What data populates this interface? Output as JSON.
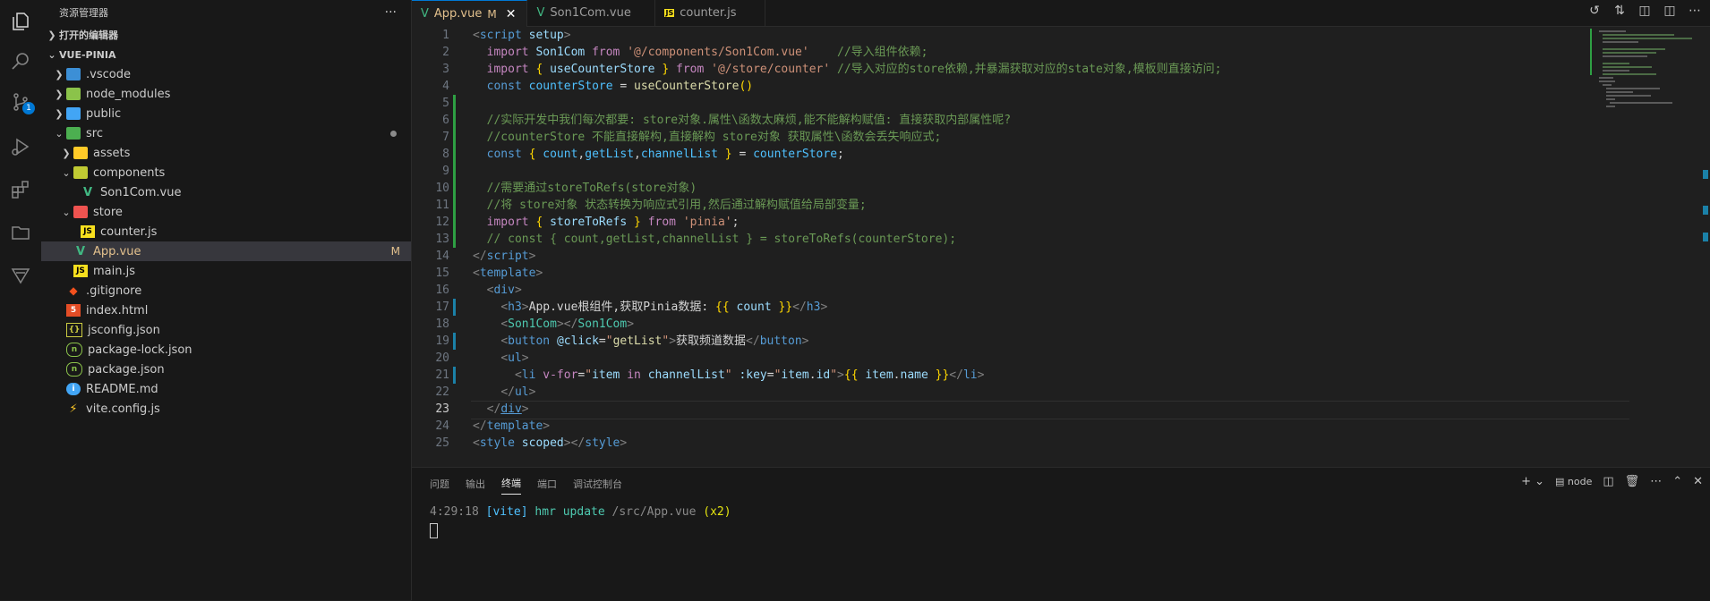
{
  "colors": {
    "accent": "#0078d4",
    "modified": "#e2c08d",
    "background": "#1f1f1f",
    "sidebar": "#181818"
  },
  "activity_bar": {
    "scm_badge": "1"
  },
  "sidebar": {
    "title": "资源管理器",
    "more": "···",
    "open_editors": "打开的编辑器",
    "project": "VUE-PINIA",
    "items": [
      {
        "label": "vscode",
        "prefix": "."
      },
      {
        "label": "node_modules"
      },
      {
        "label": "public"
      },
      {
        "label": "src"
      },
      {
        "label": "assets"
      },
      {
        "label": "components"
      },
      {
        "label": "Son1Com.vue"
      },
      {
        "label": "store"
      },
      {
        "label": "counter.js"
      },
      {
        "label": "App.vue",
        "status": "M"
      },
      {
        "label": "main.js"
      },
      {
        "label": ".gitignore"
      },
      {
        "label": "index.html"
      },
      {
        "label": "jsconfig.json"
      },
      {
        "label": "package-lock.json"
      },
      {
        "label": "package.json"
      },
      {
        "label": "README.md"
      },
      {
        "label": "vite.config.js"
      }
    ]
  },
  "tabs": [
    {
      "label": "App.vue",
      "status": "M"
    },
    {
      "label": "Son1Com.vue"
    },
    {
      "label": "counter.js"
    }
  ],
  "code": {
    "line_numbers": [
      "1",
      "2",
      "3",
      "4",
      "5",
      "6",
      "7",
      "8",
      "9",
      "10",
      "11",
      "12",
      "13",
      "14",
      "15",
      "16",
      "17",
      "18",
      "19",
      "20",
      "21",
      "22",
      "23",
      "24",
      "25"
    ],
    "current_line": "23"
  },
  "panel": {
    "tabs": [
      "问题",
      "输出",
      "终端",
      "端口",
      "调试控制台"
    ],
    "active_tab": "终端",
    "shell": "node",
    "terminal": {
      "time": "4:29:18",
      "tag": "[vite]",
      "msg": " hmr update ",
      "path": "/src/App.vue",
      "count": "(x2)"
    }
  }
}
